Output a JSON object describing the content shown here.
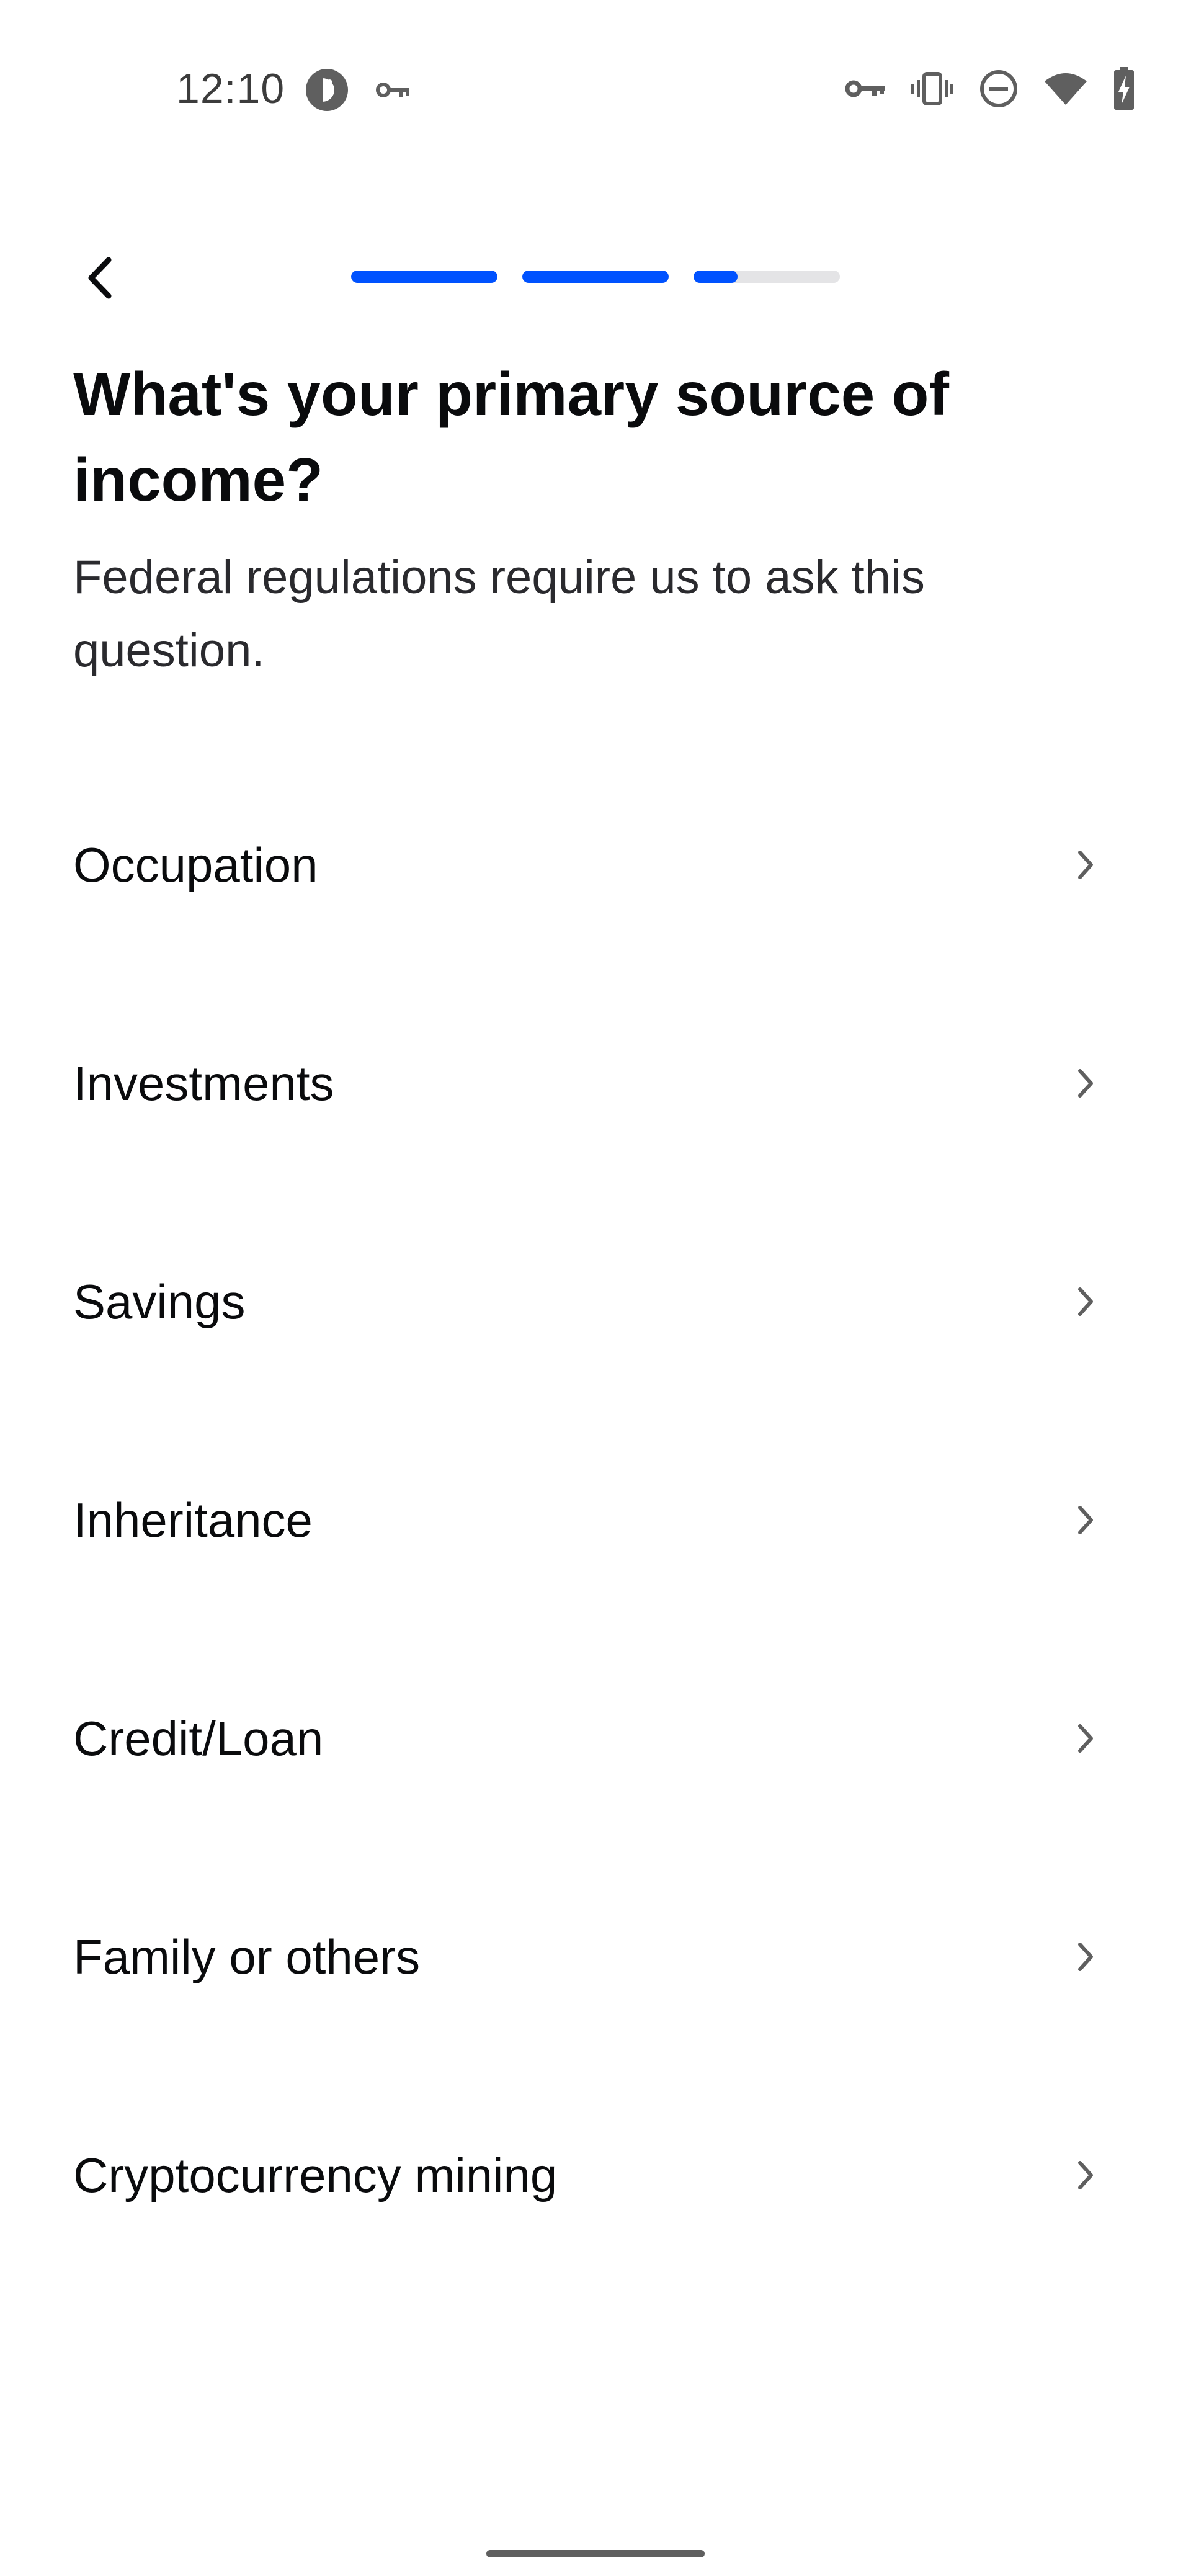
{
  "status_bar": {
    "time": "12:10",
    "left_icons": [
      "assistant-icon",
      "vpn-key-icon"
    ],
    "right_icons": [
      "vpn-key-icon",
      "vibrate-icon",
      "do-not-disturb-icon",
      "wifi-icon",
      "battery-charging-icon"
    ]
  },
  "nav": {
    "back_icon": "chevron-left-icon",
    "progress": [
      1.0,
      1.0,
      0.3
    ]
  },
  "content": {
    "title": "What's your primary source of income?",
    "subtitle": "Federal regulations require us to ask this question."
  },
  "options": [
    {
      "label": "Occupation"
    },
    {
      "label": "Investments"
    },
    {
      "label": "Savings"
    },
    {
      "label": "Inheritance"
    },
    {
      "label": "Credit/Loan"
    },
    {
      "label": "Family or others"
    },
    {
      "label": "Cryptocurrency mining"
    }
  ],
  "colors": {
    "accent": "#0052ff",
    "track": "#e4e4e6",
    "text": "#0a0b0d",
    "icon_gray": "#5f5f5f"
  }
}
